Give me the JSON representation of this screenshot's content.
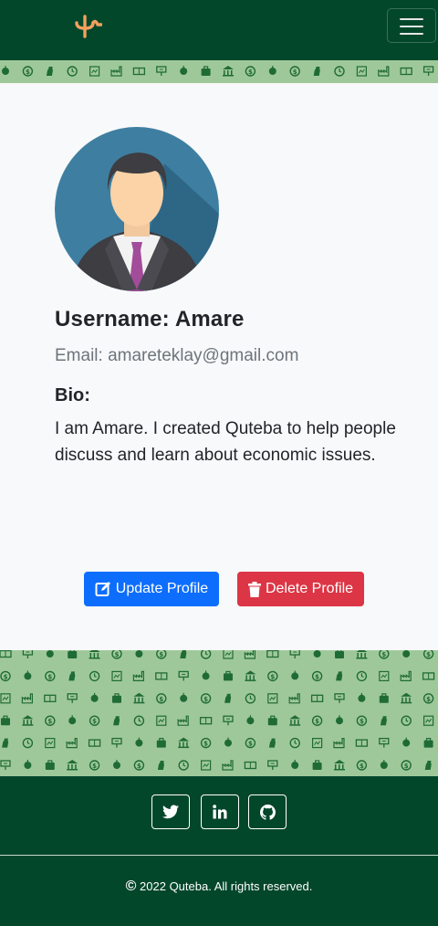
{
  "navbar": {
    "logo_icon": "quteba-logo-icon",
    "menu_icon": "hamburger-menu-icon"
  },
  "colors": {
    "navbar_bg": "#03472b",
    "pattern_bg": "#9fc89a",
    "pattern_icons": "#1f6b36",
    "logo": "#f4a15d",
    "update_button": "#0d6efd",
    "delete_button": "#dc3545"
  },
  "profile": {
    "avatar_icon": "user-avatar-businessman",
    "username": "Username: Amare",
    "email": "Email: amareteklay@gmail.com",
    "bio_title": "Bio:",
    "bio_text": "I am Amare. I created Quteba to help people discuss and learn about economic issues.",
    "update_label": "Update Profile",
    "delete_label": "Delete Profile"
  },
  "footer": {
    "social": [
      {
        "icon": "twitter-icon"
      },
      {
        "icon": "linkedin-icon"
      },
      {
        "icon": "github-icon"
      }
    ],
    "copyright_mark": "©",
    "copyright_text": "2022 Quteba. All rights reserved."
  }
}
